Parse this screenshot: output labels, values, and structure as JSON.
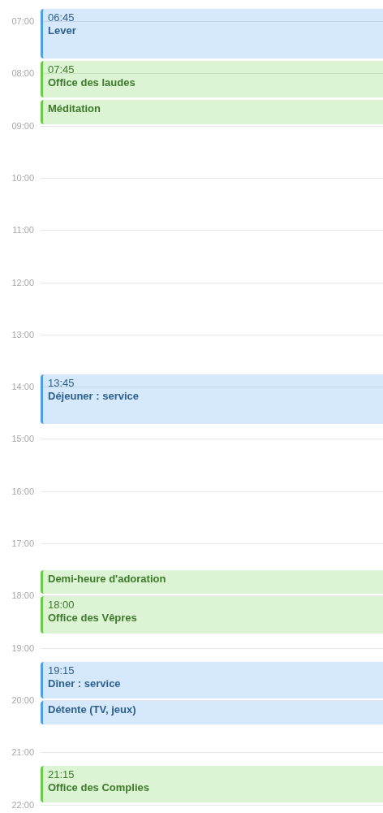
{
  "hours": [
    "07:00",
    "08:00",
    "09:00",
    "10:00",
    "11:00",
    "12:00",
    "13:00",
    "14:00",
    "15:00",
    "16:00",
    "17:00",
    "18:00",
    "19:00",
    "20:00",
    "21:00",
    "22:00"
  ],
  "events": [
    {
      "time": "06:45",
      "title": "Lever",
      "color": "#4a9ff0"
    },
    {
      "time": "07:45",
      "title": "Office des laudes",
      "color": "#66cc44"
    },
    {
      "title": "Méditation",
      "color": "#66cc44"
    },
    {
      "time": "13:45",
      "title": "Déjeuner : service",
      "color": "#4a9ff0"
    },
    {
      "title": "Demi-heure d'adoration",
      "color": "#66cc44"
    },
    {
      "time": "18:00",
      "title": "Office des Vêpres",
      "color": "#66cc44"
    },
    {
      "time": "19:15",
      "title": "Dîner : service",
      "color": "#4a9ff0"
    },
    {
      "title": "Détente (TV, jeux)",
      "color": "#4a9ff0"
    },
    {
      "time": "21:15",
      "title": "Office des Complies",
      "color": "#66cc44"
    }
  ]
}
